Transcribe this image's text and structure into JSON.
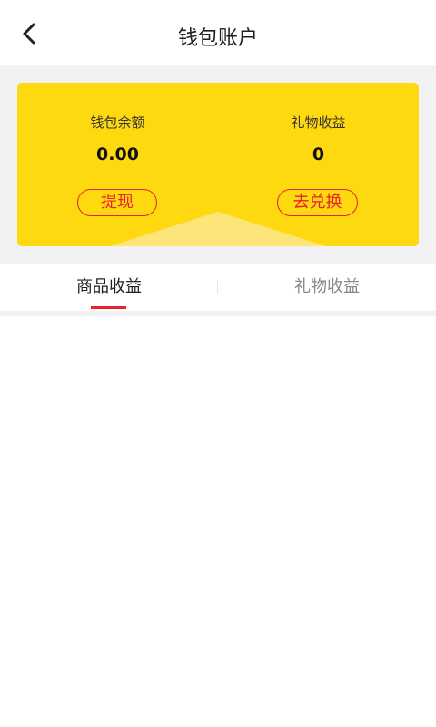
{
  "header": {
    "title": "钱包账户",
    "back_icon": "chevron-left-icon"
  },
  "wallet": {
    "balance_label": "钱包余额",
    "balance_value": "0.00",
    "withdraw_button": "提现",
    "gift_label": "礼物收益",
    "gift_value": "0",
    "exchange_button": "去兑换"
  },
  "tabs": [
    {
      "label": "商品收益",
      "active": true
    },
    {
      "label": "礼物收益",
      "active": false
    }
  ],
  "colors": {
    "card_bg": "#fed90f",
    "accent_red": "#e8222b",
    "band_bg": "#f2f2f5"
  }
}
